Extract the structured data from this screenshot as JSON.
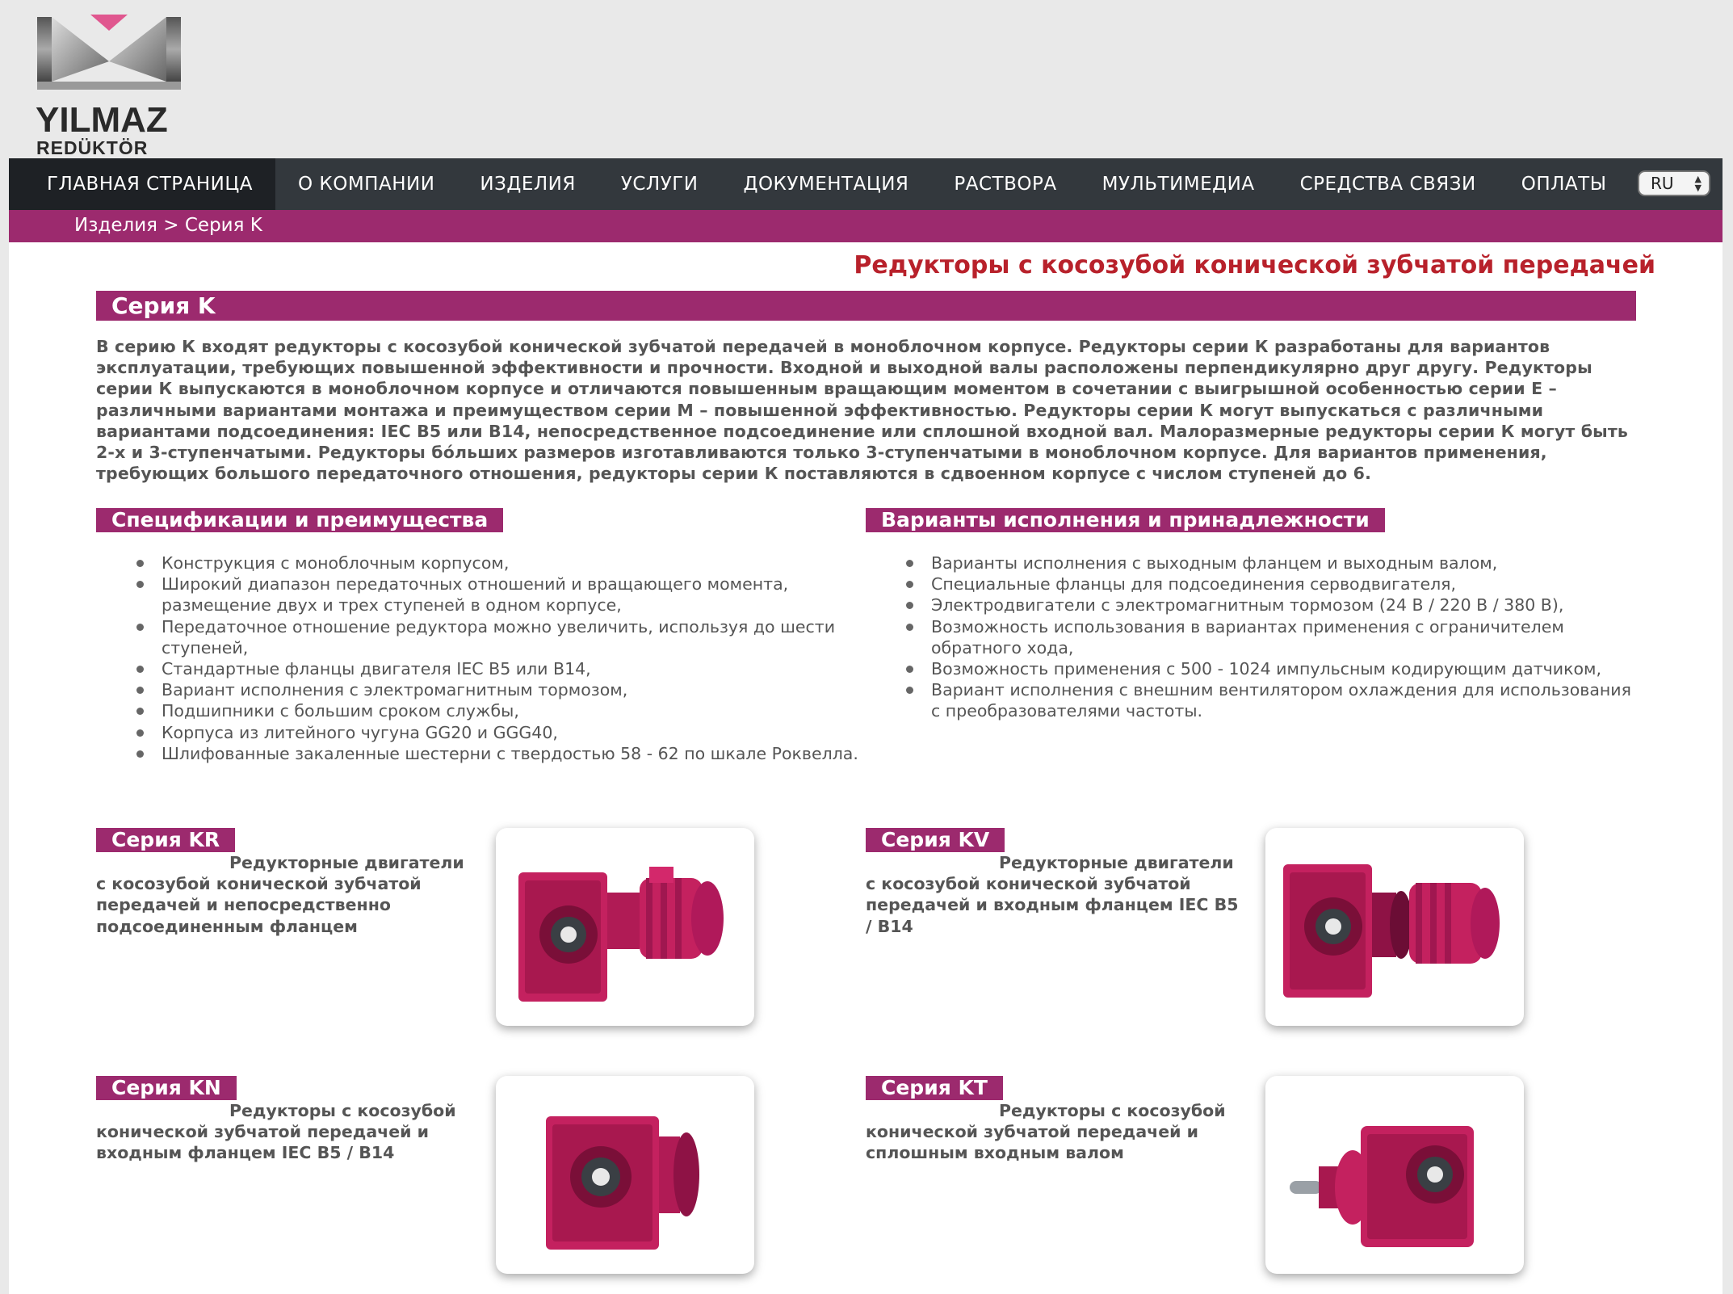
{
  "logo": {
    "name": "YILMAZ",
    "sub": "REDÜKTÖR"
  },
  "nav": {
    "items": [
      "ГЛАВНАЯ СТРАНИЦА",
      "О КОМПАНИИ",
      "ИЗДЕЛИЯ",
      "УСЛУГИ",
      "ДОКУМЕНТАЦИЯ",
      "РАСТВОРА",
      "МУЛЬТИМЕДИА",
      "СРЕДСТВА СВЯЗИ",
      "ОПЛАТЫ"
    ],
    "active_index": 0,
    "language": "RU"
  },
  "breadcrumb": "Изделия > Серия K",
  "main_title": "Редукторы с косозубой конической зубчатой передачей",
  "series_title": "Серия K",
  "intro": "В серию К входят редукторы с косозубой конической зубчатой передачей в моноблочном корпусе. Редукторы серии К разработаны для вариантов эксплуатации, требующих повышенной эффективности и прочности. Входной и выходной валы расположены перпендикулярно друг другу. Редукторы серии К выпускаются в моноблочном корпусе и отличаются повышенным вращающим моментом в сочетании с выигрышной особенностью серии Е – различными вариантами монтажа и преимуществом серии М – повышенной эффективностью. Редукторы серии К могут выпускаться с различными вариантами подсоединения: IEC B5 или B14, непосредственное подсоединение или сплошной входной вал. Малоразмерные редукторы серии К могут быть 2-х и 3-ступенчатыми. Редукторы бóльших размеров изготавливаются только 3-ступенчатыми в моноблочном корпусе. Для вариантов применения, требующих большого передаточного отношения, редукторы серии К поставляются в сдвоенном корпусе с числом ступеней до 6.",
  "specs": {
    "title": "Спецификации и преимущества",
    "items": [
      "Конструкция с моноблочным корпусом,",
      "Широкий диапазон передаточных отношений и вращающего момента, размещение двух и трех ступеней в одном корпусе,",
      "Передаточное отношение редуктора можно увеличить, используя до шести ступеней,",
      "Стандартные фланцы двигателя IEC B5 или B14,",
      "Вариант исполнения с электромагнитным тормозом,",
      "Подшипники с большим сроком службы,",
      "Корпуса из литейного чугуна GG20 и GGG40,",
      "Шлифованные закаленные шестерни с твердостью 58 - 62 по шкале Роквелла."
    ]
  },
  "variants": {
    "title": "Варианты исполнения и принадлежности",
    "items": [
      "Варианты исполнения с выходным фланцем и выходным валом,",
      "Специальные фланцы для подсоединения серводвигателя,",
      "Электродвигатели с электромагнитным тормозом (24 В / 220 В / 380 В),",
      "Возможность использования в вариантах применения с ограничителем обратного хода,",
      "Возможность применения с 500 - 1024 импульсным кодирующим датчиком,",
      "Вариант исполнения с внешним вентилятором охлаждения для использования с преобразователями частоты."
    ]
  },
  "products": [
    {
      "title": "Серия KR",
      "desc": "Редукторные двигатели с косозубой конической зубчатой передачей и непосредственно подсоединенным фланцем",
      "image": "gearmotor-kr"
    },
    {
      "title": "Серия KV",
      "desc": "Редукторные двигатели с косозубой конической зубчатой передачей и входным фланцем IEC B5 / B14",
      "image": "gearmotor-kv"
    },
    {
      "title": "Серия KN",
      "desc": "Редукторы с косозубой конической зубчатой передачей и входным фланцем IEC B5 / B14",
      "image": "gearbox-kn"
    },
    {
      "title": "Серия KT",
      "desc": "Редукторы с косозубой конической зубчатой передачей и сплошным входным валом",
      "image": "gearbox-kt"
    }
  ],
  "colors": {
    "brand": "#9c2a6e",
    "title_red": "#b8212b",
    "nav_bg": "#33383d",
    "product_pink": "#c4215f"
  }
}
